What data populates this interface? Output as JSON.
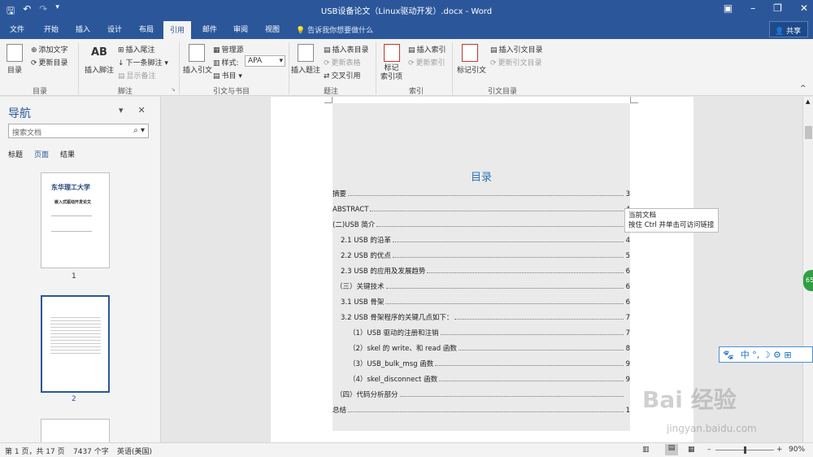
{
  "window": {
    "title": "USB设备论文（Linux驱动开发）.docx - Word"
  },
  "tabs": [
    {
      "label": "文件"
    },
    {
      "label": "开始"
    },
    {
      "label": "插入"
    },
    {
      "label": "设计"
    },
    {
      "label": "布局"
    },
    {
      "label": "引用"
    },
    {
      "label": "邮件"
    },
    {
      "label": "审阅"
    },
    {
      "label": "视图"
    }
  ],
  "active_tab": "引用",
  "tell_me": "告诉我你想要做什么",
  "share_label": "共享",
  "ribbon": {
    "toc": {
      "big": "目录",
      "add_text": "添加文字",
      "update": "更新目录",
      "group": "目录"
    },
    "footnotes": {
      "insert_footnote": "插入脚注",
      "insert_endnote": "插入尾注",
      "next_footnote": "下一条脚注",
      "show_notes": "显示备注",
      "group": "脚注",
      "ab_glyph": "AB"
    },
    "citations": {
      "insert_citation": "插入引文",
      "manage_sources": "管理源",
      "style_label": "样式:",
      "style_value": "APA",
      "bibliography": "书目",
      "group": "引文与书目"
    },
    "captions": {
      "insert_caption": "插入题注",
      "insert_tof": "插入表目录",
      "update_table": "更新表格",
      "cross_ref": "交叉引用",
      "group": "题注"
    },
    "index": {
      "mark_entry": "标记\n索引项",
      "insert_index": "插入索引",
      "update_index": "更新索引",
      "group": "索引"
    },
    "toa": {
      "mark_citation": "标记引文",
      "insert_toa": "插入引文目录",
      "update_toa": "更新引文目录",
      "group": "引文目录"
    }
  },
  "nav": {
    "title": "导航",
    "search_placeholder": "搜索文档",
    "tabs": [
      "标题",
      "页面",
      "结果"
    ],
    "active_tab": "页面",
    "pages": [
      "1",
      "2"
    ],
    "thumb1_university": "东华理工大学",
    "thumb1_title": "嵌入式驱动开发论文"
  },
  "document": {
    "toc_title": "目录",
    "entries": [
      {
        "text": "摘要",
        "page": "3",
        "level": 0
      },
      {
        "text": "ABSTRACT",
        "page": "4",
        "level": 0
      },
      {
        "text": "(二)USB 简介",
        "page": "4",
        "level": 0
      },
      {
        "text": "2.1 USB 的沿革",
        "page": "4",
        "level": 1
      },
      {
        "text": "2.2 USB 的优点",
        "page": "5",
        "level": 1
      },
      {
        "text": "2.3 USB 的应用及发展趋势",
        "page": "6",
        "level": 1
      },
      {
        "text": "（三）关键技术",
        "page": "6",
        "level": 0.5
      },
      {
        "text": "3.1 USB 骨架",
        "page": "6",
        "level": 1
      },
      {
        "text": "3.2 USB 骨架程序的关键几点如下：",
        "page": "7",
        "level": 1
      },
      {
        "text": "（1）USB 驱动的注册和注销",
        "page": "7",
        "level": 2
      },
      {
        "text": "（2）skel 的 write、和 read 函数",
        "page": "8",
        "level": 2
      },
      {
        "text": "（3）USB_bulk_msg 函数",
        "page": "9",
        "level": 2
      },
      {
        "text": "（4）skel_disconnect 函数",
        "page": "9",
        "level": 2
      },
      {
        "text": "（四）代码分析部分",
        "page": "",
        "level": 0.5
      },
      {
        "text": "总结",
        "page": "1",
        "level": 0
      }
    ],
    "tooltip_line1": "当前文档",
    "tooltip_line2": "按住 Ctrl 并单击可访问链接"
  },
  "status": {
    "page_info": "第 1 页，共 17 页",
    "word_count": "7437 个字",
    "language": "英语(美国)",
    "zoom": "90%",
    "zoom_fraction": 0.5
  },
  "ime_bar": "中 °, ☽ ⚙ ⊞",
  "badge_text": "65",
  "watermark": "Bai 经验",
  "watermark_url": "jingyan.baidu.com"
}
